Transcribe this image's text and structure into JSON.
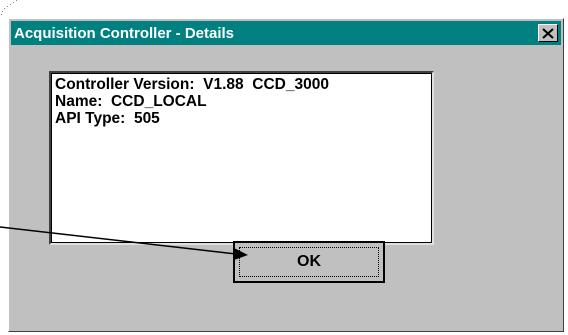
{
  "window": {
    "title": "Acquisition Controller - Details",
    "close_icon": "close-icon",
    "titlebar_color": "#008080"
  },
  "details": {
    "lines": [
      "Controller Version:  V1.88  CCD_3000",
      "Name:  CCD_LOCAL",
      "API Type:  505"
    ]
  },
  "ok_button": {
    "label": "OK"
  }
}
